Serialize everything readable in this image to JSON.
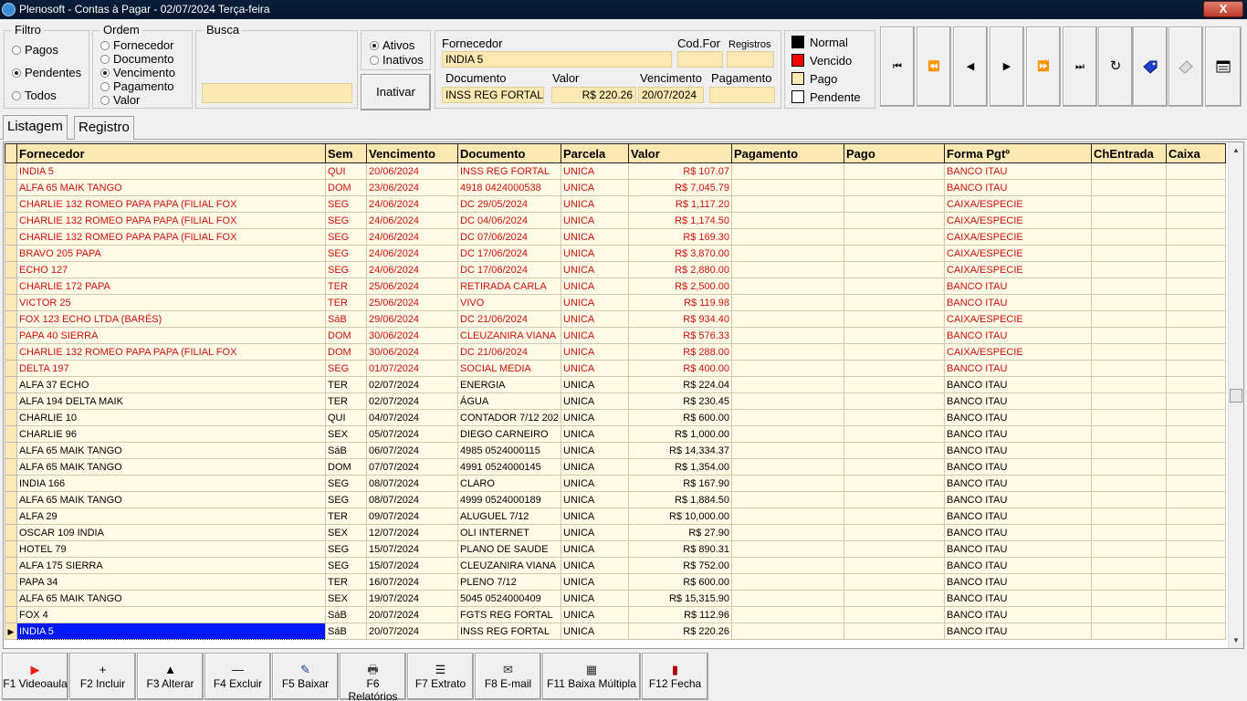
{
  "window": {
    "title": "Plenosoft - Contas à Pagar - 02/07/2024 Terça-feira",
    "close_label": "X"
  },
  "filtro": {
    "title": "Filtro",
    "options": [
      "Pagos",
      "Pendentes",
      "Todos"
    ],
    "selected": "Pendentes"
  },
  "ordem": {
    "title": "Ordem",
    "options": [
      "Fornecedor",
      "Documento",
      "Vencimento",
      "Pagamento",
      "Valor"
    ],
    "selected": "Vencimento"
  },
  "busca": {
    "title": "Busca",
    "value": ""
  },
  "status": {
    "options": [
      "Ativos",
      "Inativos"
    ],
    "selected": "Ativos",
    "inativar_label": "Inativar"
  },
  "detail": {
    "fornecedor_label": "Fornecedor",
    "fornecedor": "INDIA 5",
    "codfor_label": "Cod.For",
    "codfor": "",
    "registros_label": "Registros",
    "registros": "",
    "documento_label": "Documento",
    "documento": "INSS REG FORTAL",
    "valor_label": "Valor",
    "valor": "R$ 220.26",
    "vencimento_label": "Vencimento",
    "vencimento": "20/07/2024",
    "pagamento_label": "Pagamento",
    "pagamento": ""
  },
  "legend": [
    {
      "label": "Normal",
      "color": "#000000"
    },
    {
      "label": "Vencido",
      "color": "#ff0000"
    },
    {
      "label": "Pago",
      "color": "#fce8b2"
    },
    {
      "label": "Pendente",
      "color": "#ffffff"
    }
  ],
  "nav": {
    "first": "⏮",
    "prev_page": "⏪",
    "prev": "◀",
    "next": "▶",
    "next_page": "⏩",
    "last": "⏭",
    "refresh": "↻"
  },
  "tabs": [
    "Listagem",
    "Registro"
  ],
  "columns": [
    "Fornecedor",
    "Sem",
    "Vencimento",
    "Documento",
    "Parcela",
    "Valor",
    "Pagamento",
    "Pago",
    "Forma Pgtº",
    "ChEntrada",
    "Caixa"
  ],
  "rows": [
    {
      "fornecedor": "INDIA 5",
      "sem": "QUI",
      "venc": "20/06/2024",
      "doc": "INSS REG FORTAL",
      "parcela": "UNICA",
      "valor": "R$ 107.07",
      "pagamento": "",
      "pago": "",
      "forma": "BANCO ITAU",
      "chentrada": "",
      "caixa": "",
      "status": "vencido"
    },
    {
      "fornecedor": "ALFA 65 MAIK TANGO",
      "sem": "DOM",
      "venc": "23/06/2024",
      "doc": "4918 0424000538",
      "parcela": "UNICA",
      "valor": "R$ 7,045.79",
      "pagamento": "",
      "pago": "",
      "forma": "BANCO ITAU",
      "chentrada": "",
      "caixa": "",
      "status": "vencido"
    },
    {
      "fornecedor": "CHARLIE 132 ROMEO PAPA PAPA (FILIAL FOX",
      "sem": "SEG",
      "venc": "24/06/2024",
      "doc": "DC 29/05/2024",
      "parcela": "UNICA",
      "valor": "R$ 1,117.20",
      "pagamento": "",
      "pago": "",
      "forma": "CAIXA/ESPECIE",
      "chentrada": "",
      "caixa": "",
      "status": "vencido"
    },
    {
      "fornecedor": "CHARLIE 132 ROMEO PAPA PAPA (FILIAL FOX",
      "sem": "SEG",
      "venc": "24/06/2024",
      "doc": "DC 04/06/2024",
      "parcela": "UNICA",
      "valor": "R$ 1,174.50",
      "pagamento": "",
      "pago": "",
      "forma": "CAIXA/ESPECIE",
      "chentrada": "",
      "caixa": "",
      "status": "vencido"
    },
    {
      "fornecedor": "CHARLIE 132 ROMEO PAPA PAPA (FILIAL FOX",
      "sem": "SEG",
      "venc": "24/06/2024",
      "doc": "DC 07/06/2024",
      "parcela": "UNICA",
      "valor": "R$ 169.30",
      "pagamento": "",
      "pago": "",
      "forma": "CAIXA/ESPECIE",
      "chentrada": "",
      "caixa": "",
      "status": "vencido"
    },
    {
      "fornecedor": "BRAVO 205 PAPA",
      "sem": "SEG",
      "venc": "24/06/2024",
      "doc": "DC 17/06/2024",
      "parcela": "UNICA",
      "valor": "R$ 3,870.00",
      "pagamento": "",
      "pago": "",
      "forma": "CAIXA/ESPECIE",
      "chentrada": "",
      "caixa": "",
      "status": "vencido"
    },
    {
      "fornecedor": "ECHO 127",
      "sem": "SEG",
      "venc": "24/06/2024",
      "doc": "DC 17/06/2024",
      "parcela": "UNICA",
      "valor": "R$ 2,880.00",
      "pagamento": "",
      "pago": "",
      "forma": "CAIXA/ESPECIE",
      "chentrada": "",
      "caixa": "",
      "status": "vencido"
    },
    {
      "fornecedor": "CHARLIE 172 PAPA",
      "sem": "TER",
      "venc": "25/06/2024",
      "doc": "RETIRADA CARLA",
      "parcela": "UNICA",
      "valor": "R$ 2,500.00",
      "pagamento": "",
      "pago": "",
      "forma": "BANCO ITAU",
      "chentrada": "",
      "caixa": "",
      "status": "vencido"
    },
    {
      "fornecedor": "VICTOR 25",
      "sem": "TER",
      "venc": "25/06/2024",
      "doc": "VIVO",
      "parcela": "UNICA",
      "valor": "R$ 119.98",
      "pagamento": "",
      "pago": "",
      "forma": "BANCO ITAU",
      "chentrada": "",
      "caixa": "",
      "status": "vencido"
    },
    {
      "fornecedor": "FOX 123 ECHO LTDA (BARÉS)",
      "sem": "SáB",
      "venc": "29/06/2024",
      "doc": "DC 21/06/2024",
      "parcela": "UNICA",
      "valor": "R$ 934.40",
      "pagamento": "",
      "pago": "",
      "forma": "CAIXA/ESPECIE",
      "chentrada": "",
      "caixa": "",
      "status": "vencido"
    },
    {
      "fornecedor": "PAPA 40 SIERRA",
      "sem": "DOM",
      "venc": "30/06/2024",
      "doc": "CLEUZANIRA VIANA",
      "parcela": "UNICA",
      "valor": "R$ 576.33",
      "pagamento": "",
      "pago": "",
      "forma": "BANCO ITAU",
      "chentrada": "",
      "caixa": "",
      "status": "vencido"
    },
    {
      "fornecedor": "CHARLIE 132 ROMEO PAPA PAPA (FILIAL FOX",
      "sem": "DOM",
      "venc": "30/06/2024",
      "doc": "DC 21/06/2024",
      "parcela": "UNICA",
      "valor": "R$ 288.00",
      "pagamento": "",
      "pago": "",
      "forma": "CAIXA/ESPECIE",
      "chentrada": "",
      "caixa": "",
      "status": "vencido"
    },
    {
      "fornecedor": "DELTA 197",
      "sem": "SEG",
      "venc": "01/07/2024",
      "doc": "SOCIAL MEDIA",
      "parcela": "UNICA",
      "valor": "R$ 400.00",
      "pagamento": "",
      "pago": "",
      "forma": "BANCO ITAU",
      "chentrada": "",
      "caixa": "",
      "status": "vencido"
    },
    {
      "fornecedor": "ALFA 37 ECHO",
      "sem": "TER",
      "venc": "02/07/2024",
      "doc": "ENERGIA",
      "parcela": "UNICA",
      "valor": "R$ 224.04",
      "pagamento": "",
      "pago": "",
      "forma": "BANCO ITAU",
      "chentrada": "",
      "caixa": "",
      "status": "normal"
    },
    {
      "fornecedor": "ALFA 194 DELTA MAIK",
      "sem": "TER",
      "venc": "02/07/2024",
      "doc": "ÁGUA",
      "parcela": "UNICA",
      "valor": "R$ 230.45",
      "pagamento": "",
      "pago": "",
      "forma": "BANCO ITAU",
      "chentrada": "",
      "caixa": "",
      "status": "normal"
    },
    {
      "fornecedor": "CHARLIE 10",
      "sem": "QUI",
      "venc": "04/07/2024",
      "doc": "CONTADOR 7/12 202",
      "parcela": "UNICA",
      "valor": "R$ 600.00",
      "pagamento": "",
      "pago": "",
      "forma": "BANCO ITAU",
      "chentrada": "",
      "caixa": "",
      "status": "normal"
    },
    {
      "fornecedor": "CHARLIE 96",
      "sem": "SEX",
      "venc": "05/07/2024",
      "doc": "DIEGO CARNEIRO",
      "parcela": "UNICA",
      "valor": "R$ 1,000.00",
      "pagamento": "",
      "pago": "",
      "forma": "BANCO ITAU",
      "chentrada": "",
      "caixa": "",
      "status": "normal"
    },
    {
      "fornecedor": "ALFA 65 MAIK TANGO",
      "sem": "SáB",
      "venc": "06/07/2024",
      "doc": "4985 0524000115",
      "parcela": "UNICA",
      "valor": "R$ 14,334.37",
      "pagamento": "",
      "pago": "",
      "forma": "BANCO ITAU",
      "chentrada": "",
      "caixa": "",
      "status": "normal"
    },
    {
      "fornecedor": "ALFA 65 MAIK TANGO",
      "sem": "DOM",
      "venc": "07/07/2024",
      "doc": "4991 0524000145",
      "parcela": "UNICA",
      "valor": "R$ 1,354.00",
      "pagamento": "",
      "pago": "",
      "forma": "BANCO ITAU",
      "chentrada": "",
      "caixa": "",
      "status": "normal"
    },
    {
      "fornecedor": "INDIA 166",
      "sem": "SEG",
      "venc": "08/07/2024",
      "doc": "CLARO",
      "parcela": "UNICA",
      "valor": "R$ 167.90",
      "pagamento": "",
      "pago": "",
      "forma": "BANCO ITAU",
      "chentrada": "",
      "caixa": "",
      "status": "normal"
    },
    {
      "fornecedor": "ALFA 65 MAIK TANGO",
      "sem": "SEG",
      "venc": "08/07/2024",
      "doc": "4999 0524000189",
      "parcela": "UNICA",
      "valor": "R$ 1,884.50",
      "pagamento": "",
      "pago": "",
      "forma": "BANCO ITAU",
      "chentrada": "",
      "caixa": "",
      "status": "normal"
    },
    {
      "fornecedor": "ALFA 29",
      "sem": "TER",
      "venc": "09/07/2024",
      "doc": "ALUGUEL 7/12",
      "parcela": "UNICA",
      "valor": "R$ 10,000.00",
      "pagamento": "",
      "pago": "",
      "forma": "BANCO ITAU",
      "chentrada": "",
      "caixa": "",
      "status": "normal"
    },
    {
      "fornecedor": "OSCAR 109 INDIA",
      "sem": "SEX",
      "venc": "12/07/2024",
      "doc": "OLI INTERNET",
      "parcela": "UNICA",
      "valor": "R$ 27.90",
      "pagamento": "",
      "pago": "",
      "forma": "BANCO ITAU",
      "chentrada": "",
      "caixa": "",
      "status": "normal"
    },
    {
      "fornecedor": "HOTEL 79",
      "sem": "SEG",
      "venc": "15/07/2024",
      "doc": "PLANO DE SAUDE",
      "parcela": "UNICA",
      "valor": "R$ 890.31",
      "pagamento": "",
      "pago": "",
      "forma": "BANCO ITAU",
      "chentrada": "",
      "caixa": "",
      "status": "normal"
    },
    {
      "fornecedor": "ALFA 175 SIERRA",
      "sem": "SEG",
      "venc": "15/07/2024",
      "doc": "CLEUZANIRA VIANA",
      "parcela": "UNICA",
      "valor": "R$ 752.00",
      "pagamento": "",
      "pago": "",
      "forma": "BANCO ITAU",
      "chentrada": "",
      "caixa": "",
      "status": "normal"
    },
    {
      "fornecedor": "PAPA 34",
      "sem": "TER",
      "venc": "16/07/2024",
      "doc": "PLENO 7/12",
      "parcela": "UNICA",
      "valor": "R$ 600.00",
      "pagamento": "",
      "pago": "",
      "forma": "BANCO ITAU",
      "chentrada": "",
      "caixa": "",
      "status": "normal"
    },
    {
      "fornecedor": "ALFA 65 MAIK TANGO",
      "sem": "SEX",
      "venc": "19/07/2024",
      "doc": "5045 0524000409",
      "parcela": "UNICA",
      "valor": "R$ 15,315.90",
      "pagamento": "",
      "pago": "",
      "forma": "BANCO ITAU",
      "chentrada": "",
      "caixa": "",
      "status": "normal"
    },
    {
      "fornecedor": "FOX 4",
      "sem": "SáB",
      "venc": "20/07/2024",
      "doc": "FGTS REG FORTAL",
      "parcela": "UNICA",
      "valor": "R$ 112.96",
      "pagamento": "",
      "pago": "",
      "forma": "BANCO ITAU",
      "chentrada": "",
      "caixa": "",
      "status": "normal"
    },
    {
      "fornecedor": "INDIA 5",
      "sem": "SáB",
      "venc": "20/07/2024",
      "doc": "INSS REG FORTAL",
      "parcela": "UNICA",
      "valor": "R$ 220.26",
      "pagamento": "",
      "pago": "",
      "forma": "BANCO ITAU",
      "chentrada": "",
      "caixa": "",
      "status": "normal",
      "selected": true
    }
  ],
  "footer": [
    {
      "label": "F1 Videoaula",
      "icon": "▶",
      "icon_name": "youtube-icon",
      "color": "#e62117"
    },
    {
      "label": "F2 Incluir",
      "icon": "+",
      "icon_name": "plus-icon",
      "color": "#000000"
    },
    {
      "label": "F3 Alterar",
      "icon": "▲",
      "icon_name": "up-arrow-icon",
      "color": "#000000"
    },
    {
      "label": "F4 Excluir",
      "icon": "—",
      "icon_name": "minus-icon",
      "color": "#000000"
    },
    {
      "label": "F5 Baixar",
      "icon": "✎",
      "icon_name": "pay-icon",
      "color": "#1a3a8a"
    },
    {
      "label": "F6 Relatórios",
      "icon": "🖶",
      "icon_name": "printer-icon",
      "color": "#444444"
    },
    {
      "label": "F7 Extrato",
      "icon": "☰",
      "icon_name": "list-icon",
      "color": "#000000"
    },
    {
      "label": "F8 E-mail",
      "icon": "✉",
      "icon_name": "email-icon",
      "color": "#333333"
    },
    {
      "label": "F11 Baixa Múltipla",
      "icon": "▦",
      "icon_name": "multi-pay-icon",
      "color": "#333333"
    },
    {
      "label": "F12 Fecha",
      "icon": "▮",
      "icon_name": "close-door-icon",
      "color": "#b00000"
    }
  ]
}
